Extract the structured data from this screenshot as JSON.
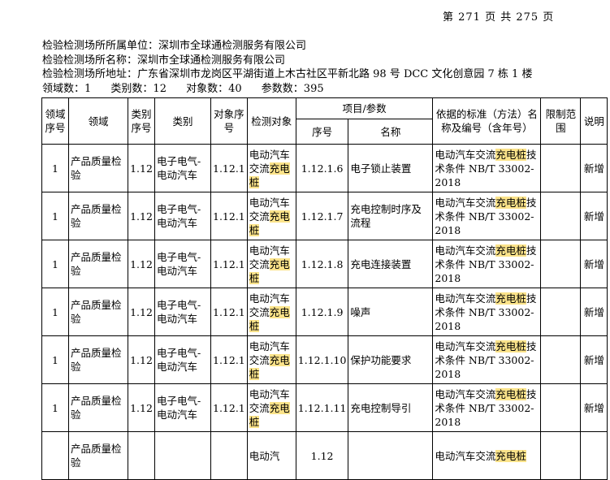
{
  "page_number": "第 271 页 共 275 页",
  "info": {
    "unit": "检验检测场所所属单位：深圳市全球通检测服务有限公司",
    "name": "检验检测场所名称：深圳市全球通检测服务有限公司",
    "address": "检验检测场所地址：广东省深圳市龙岗区平湖街道上木古社区平新北路 98 号 DCC 文化创意园 7 栋 1 楼",
    "counts": {
      "domain": "领域数：1",
      "category": "类别数：12",
      "object": "对象数：40",
      "param": "参数数：395"
    }
  },
  "table": {
    "headers": {
      "domain_no": "领域序号",
      "domain": "领域",
      "category_no": "类别序号",
      "category": "类别",
      "object_no": "对象序号",
      "object": "检测对象",
      "item_param": "项目/参数",
      "item_no": "序号",
      "item_name": "名称",
      "standard": "依据的标准（方法）名称及编号（含年号）",
      "limit": "限制范围",
      "note": "说明"
    },
    "rows": [
      {
        "domain_no": "1",
        "domain": "产品质量检验",
        "category_no": "1.12",
        "category": "电子电气-电动汽车",
        "object_no": "1.12.1",
        "object_a": "电动汽车交流",
        "object_hl": "充电桩",
        "item_no": "1.12.1.6",
        "item_name": "电子锁止装置",
        "std_a": "电动汽车交流",
        "std_hl": "充电桩",
        "std_b": "技术条件 NB/T 33002-2018",
        "limit": "",
        "note": "新增"
      },
      {
        "domain_no": "1",
        "domain": "产品质量检验",
        "category_no": "1.12",
        "category": "电子电气-电动汽车",
        "object_no": "1.12.1",
        "object_a": "电动汽车交流",
        "object_hl": "充电桩",
        "item_no": "1.12.1.7",
        "item_name": "充电控制时序及流程",
        "std_a": "电动汽车交流",
        "std_hl": "充电桩",
        "std_b": "技术条件 NB/T 33002-2018",
        "limit": "",
        "note": "新增"
      },
      {
        "domain_no": "1",
        "domain": "产品质量检验",
        "category_no": "1.12",
        "category": "电子电气-电动汽车",
        "object_no": "1.12.1",
        "object_a": "电动汽车交流",
        "object_hl": "充电桩",
        "item_no": "1.12.1.8",
        "item_name": "充电连接装置",
        "std_a": "电动汽车交流",
        "std_hl": "充电桩",
        "std_b": "技术条件 NB/T 33002-2018",
        "limit": "",
        "note": "新增"
      },
      {
        "domain_no": "1",
        "domain": "产品质量检验",
        "category_no": "1.12",
        "category": "电子电气-电动汽车",
        "object_no": "1.12.1",
        "object_a": "电动汽车交流",
        "object_hl": "充电桩",
        "item_no": "1.12.1.9",
        "item_name": "噪声",
        "std_a": "电动汽车交流",
        "std_hl": "充电桩",
        "std_b": "技术条件 NB/T 33002-2018",
        "limit": "",
        "note": "新增"
      },
      {
        "domain_no": "1",
        "domain": "产品质量检验",
        "category_no": "1.12",
        "category": "电子电气-电动汽车",
        "object_no": "1.12.1",
        "object_a": "电动汽车交流",
        "object_hl": "充电桩",
        "item_no": "1.12.1.10",
        "item_name": "保护功能要求",
        "std_a": "电动汽车交流",
        "std_hl": "充电桩",
        "std_b": "技术条件 NB/T 33002-2018",
        "limit": "",
        "note": "新增"
      },
      {
        "domain_no": "1",
        "domain": "产品质量检验",
        "category_no": "1.12",
        "category": "电子电气-电动汽车",
        "object_no": "1.12.1",
        "object_a": "电动汽车交流",
        "object_hl": "充电桩",
        "item_no": "1.12.1.11",
        "item_name": "充电控制导引",
        "std_a": "电动汽车交流",
        "std_hl": "充电桩",
        "std_b": "技术条件 NB/T 33002-2018",
        "limit": "",
        "note": "新增"
      },
      {
        "domain_no": "",
        "domain": "产品质量检验",
        "category_no": "",
        "category": "",
        "object_no": "",
        "object_a": "电动汽",
        "object_hl": "",
        "item_no": "1.12",
        "item_name": "",
        "std_a": "电动汽车交流",
        "std_hl": "充电桩",
        "std_b": "",
        "limit": "",
        "note": ""
      }
    ]
  }
}
